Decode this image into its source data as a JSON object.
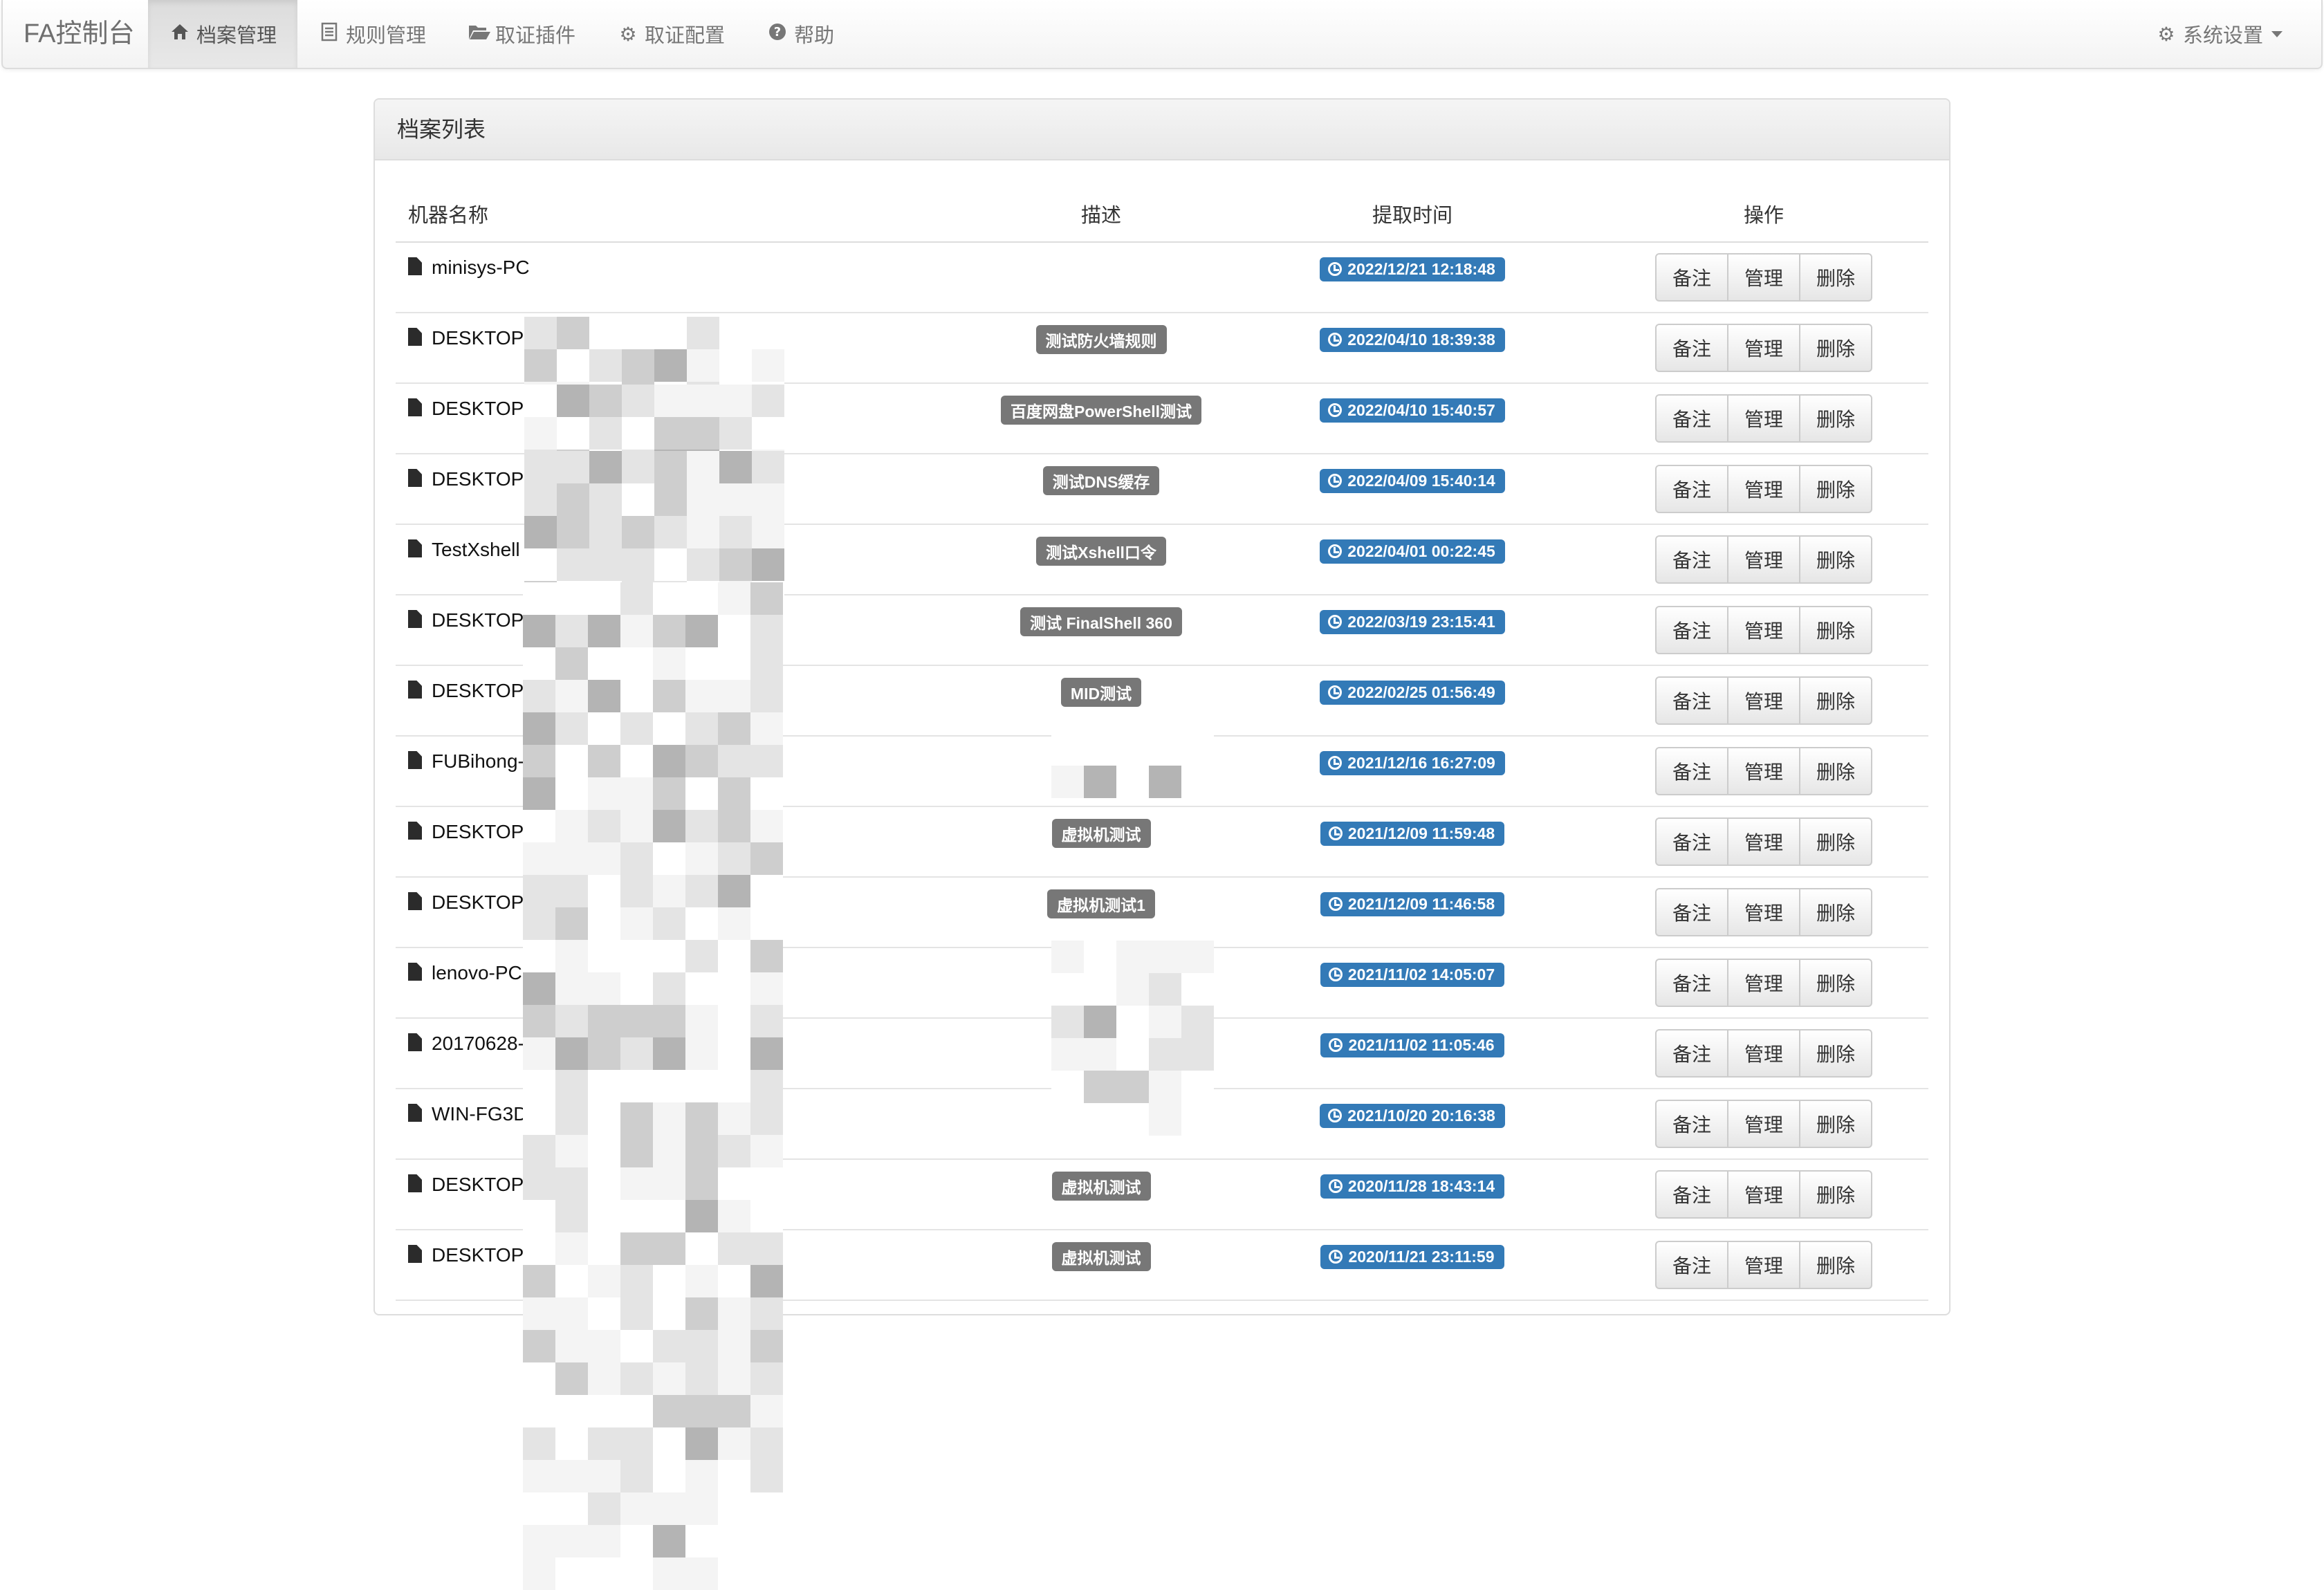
{
  "navbar": {
    "brand": "FA控制台",
    "items": [
      {
        "label": "档案管理",
        "icon": "home-icon",
        "active": true
      },
      {
        "label": "规则管理",
        "icon": "list-icon",
        "active": false
      },
      {
        "label": "取证插件",
        "icon": "folder-open-icon",
        "active": false
      },
      {
        "label": "取证配置",
        "icon": "gear-icon",
        "active": false
      },
      {
        "label": "帮助",
        "icon": "question-circle-icon",
        "active": false
      }
    ],
    "settings": {
      "label": "系统设置",
      "icon": "gear-icon"
    }
  },
  "panel": {
    "title": "档案列表",
    "columns": [
      "机器名称",
      "描述",
      "提取时间",
      "操作"
    ],
    "actions": [
      "备注",
      "管理",
      "删除"
    ],
    "rows": [
      {
        "name": "minisys-PC",
        "desc": "",
        "time": "2022/12/21 12:18:48"
      },
      {
        "name": "DESKTOP-4",
        "desc": "测试防火墙规则",
        "time": "2022/04/10 18:39:38"
      },
      {
        "name": "DESKTOP-4",
        "desc": "百度网盘PowerShell测试",
        "time": "2022/04/10 15:40:57"
      },
      {
        "name": "DESKTOP-9",
        "desc": "测试DNS缓存",
        "time": "2022/04/09 15:40:14"
      },
      {
        "name": "TestXshell",
        "desc": "测试Xshell口令",
        "time": "2022/04/01 00:22:45"
      },
      {
        "name": "DESKTOP-",
        "desc": "测试 FinalShell 360",
        "time": "2022/03/19 23:15:41"
      },
      {
        "name": "DESKTOP-",
        "desc": "MID测试",
        "time": "2022/02/25 01:56:49"
      },
      {
        "name": "FUBihong-",
        "desc": "",
        "time": "2021/12/16 16:27:09"
      },
      {
        "name": "DESKTOP-",
        "desc": "虚拟机测试",
        "time": "2021/12/09 11:59:48"
      },
      {
        "name": "DESKTOP-",
        "desc": "虚拟机测试1",
        "time": "2021/12/09 11:46:58"
      },
      {
        "name": "lenovo-PC",
        "desc": "",
        "time": "2021/11/02 14:05:07"
      },
      {
        "name": "20170628-",
        "desc": "",
        "time": "2021/11/02 11:05:46"
      },
      {
        "name": "WIN-FG3D",
        "desc": "",
        "time": "2021/10/20 20:16:38"
      },
      {
        "name": "DESKTOP-",
        "desc": "虚拟机测试",
        "time": "2020/11/28 18:43:14"
      },
      {
        "name": "DESKTOP-",
        "desc": "虚拟机测试",
        "time": "2020/11/21 23:11:59"
      }
    ]
  },
  "colors": {
    "time_badge": "#337ab7",
    "desc_badge": "#777777"
  }
}
